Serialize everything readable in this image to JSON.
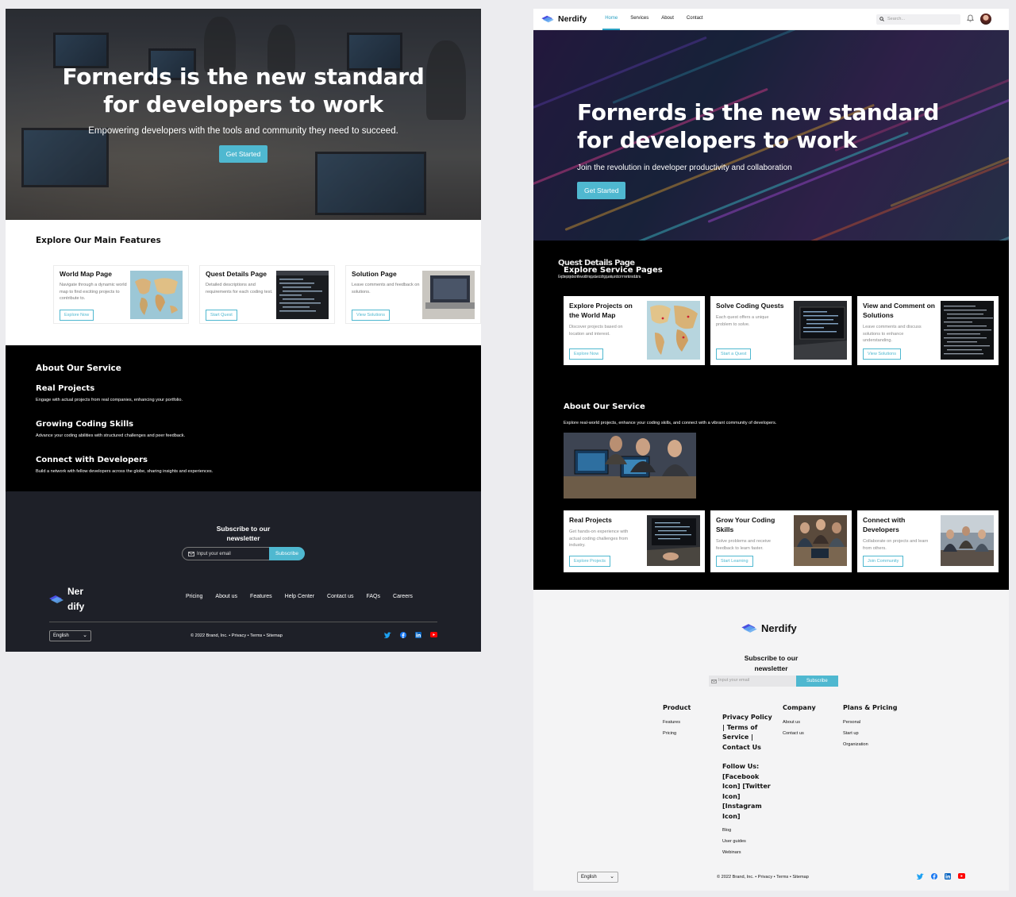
{
  "left": {
    "hero": {
      "title": "Fornerds is the new standard for developers to work",
      "subtitle": "Empowering developers with the tools and community they need to succeed.",
      "cta": "Get Started"
    },
    "features": {
      "title": "Explore Our Main Features",
      "cards": [
        {
          "title": "World Map Page",
          "desc": "Navigate through a dynamic world map to find exciting projects to contribute to.",
          "button": "Explore Now"
        },
        {
          "title": "Quest Details Page",
          "desc": "Detailed descriptions and requirements for each coding test.",
          "button": "Start Quest"
        },
        {
          "title": "Solution Page",
          "desc": "Leave comments and feedback on solutions.",
          "button": "View Solutions"
        }
      ]
    },
    "about": {
      "title": "About Our Service",
      "items": [
        {
          "title": "Real Projects",
          "desc": "Engage with actual projects from real companies, enhancing your portfolio."
        },
        {
          "title": "Growing Coding Skills",
          "desc": "Advance your coding abilities with structured challenges and peer feedback."
        },
        {
          "title": "Connect with Developers",
          "desc": "Build a network with fellow developers across the globe, sharing insights and experiences."
        }
      ]
    },
    "footer": {
      "subscribe_title": "Subscribe to our newsletter",
      "email_placeholder": "Input your email",
      "subscribe_button": "Subscribe",
      "brand_line1": "Ner",
      "brand_line2": "dify",
      "links": [
        "Pricing",
        "About us",
        "Features",
        "Help Center",
        "Contact us",
        "FAQs",
        "Careers"
      ],
      "language": "English",
      "copyright": "© 2022 Brand, Inc. • Privacy • Terms • Sitemap"
    }
  },
  "right": {
    "nav": {
      "brand": "Nerdify",
      "links": [
        "Home",
        "Services",
        "About",
        "Contact"
      ],
      "active": "Home",
      "search_placeholder": "Search..."
    },
    "hero": {
      "title": "Fornerds is the new standard for developers to work",
      "subtitle": "Join the revolution in developer productivity and collaboration",
      "cta": "Get Started"
    },
    "explore": {
      "title": "Explore Service Pages",
      "ghost_title": "Quest Details Page",
      "ghost_text": "Explore projects on the world map, solve coding quests, and comment on solutions.",
      "cards": [
        {
          "title": "Explore Projects on the World Map",
          "desc": "Discover projects based on location and interest.",
          "button": "Explore Now"
        },
        {
          "title": "Solve Coding Quests",
          "desc": "Each quest offers a unique problem to solve.",
          "button": "Start a Quest"
        },
        {
          "title": "View and Comment on Solutions",
          "desc": "Leave comments and discuss solutions to enhance understanding.",
          "button": "View Solutions"
        }
      ]
    },
    "about": {
      "title": "About Our Service",
      "subtitle": "Explore real-world projects, enhance your coding skills, and connect with a vibrant community of developers.",
      "cards": [
        {
          "title": "Real Projects",
          "desc": "Get hands-on experience with actual coding challenges from industry.",
          "button": "Explore Projects"
        },
        {
          "title": "Grow Your Coding Skills",
          "desc": "Solve problems and receive feedback to learn faster.",
          "button": "Start Learning"
        },
        {
          "title": "Connect with Developers",
          "desc": "Collaborate on projects and learn from others.",
          "button": "Join Community"
        }
      ]
    },
    "footer": {
      "brand": "Nerdify",
      "subscribe_title": "Subscribe to our newsletter",
      "email_placeholder": "Input your email",
      "subscribe_button": "Subscribe",
      "product": {
        "title": "Product",
        "items": [
          "Features",
          "Pricing"
        ]
      },
      "legal": {
        "title": "Privacy Policy | Terms of Service | Contact Us",
        "follow": "Follow Us: [Facebook Icon] [Twitter Icon] [Instagram Icon]",
        "items": [
          "Blog",
          "User guides",
          "Webinars"
        ]
      },
      "company": {
        "title": "Company",
        "items": [
          "About us",
          "Contact us"
        ]
      },
      "plans": {
        "title": "Plans & Pricing",
        "items": [
          "Personal",
          "Start up",
          "Organization"
        ]
      },
      "language": "English",
      "copyright": "© 2022 Brand, Inc. • Privacy • Terms • Sitemap"
    }
  },
  "colors": {
    "accent": "#4fb8d0",
    "dark_footer": "#1e2028",
    "twitter": "#1da1f2",
    "facebook": "#1877f2",
    "linkedin": "#0a66c2",
    "youtube": "#ff0000"
  }
}
